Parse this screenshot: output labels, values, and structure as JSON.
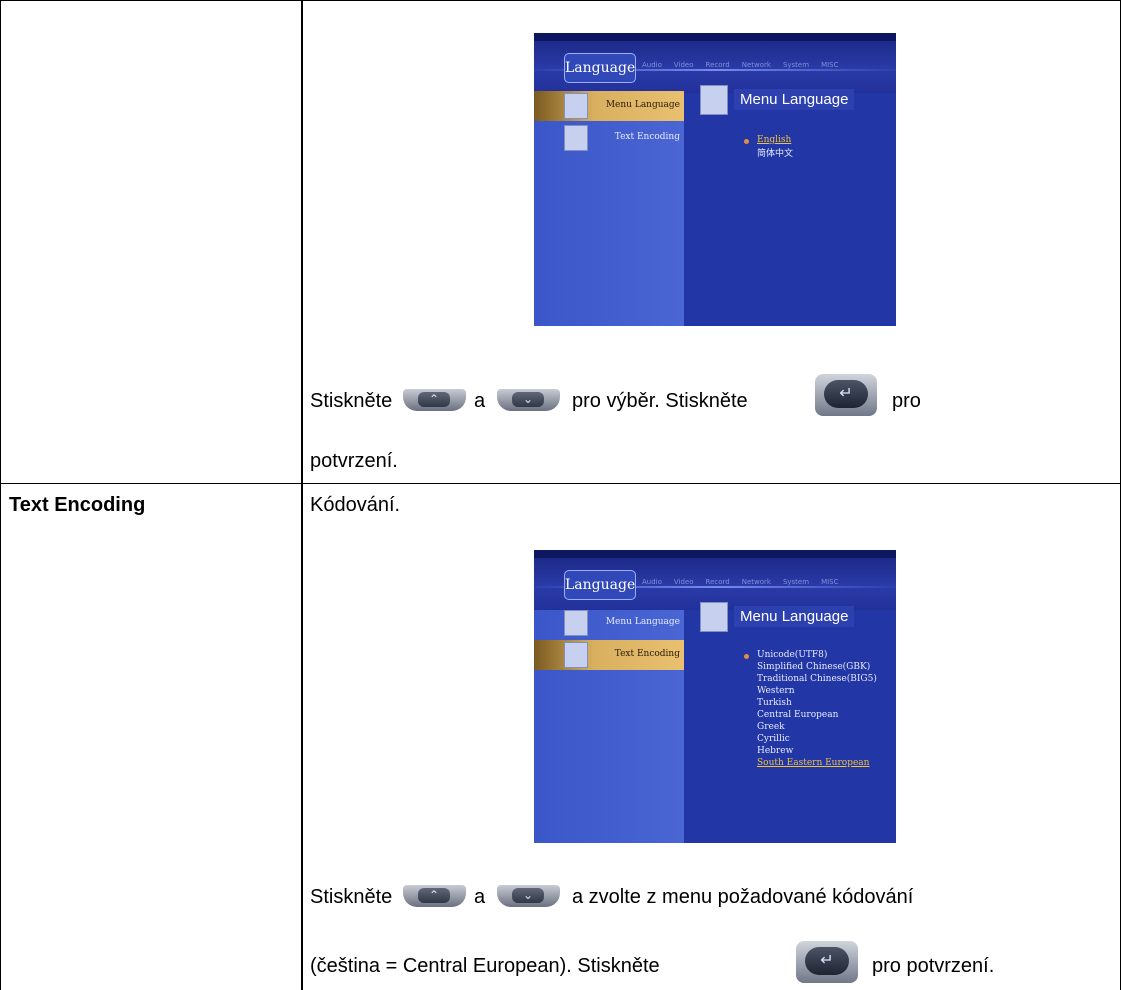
{
  "row_text_encoding": {
    "label": "Text Encoding",
    "desc": "Kódování."
  },
  "instructions_1": {
    "part1": "Stiskněte",
    "part2": "a",
    "part3": "pro výběr. Stiskněte",
    "part4": "pro",
    "line2": "potvrzení."
  },
  "instructions_2": {
    "part1": "Stiskněte",
    "part2": "a",
    "part3": "a zvolte z menu požadované kódování",
    "line2a": "(čeština = Central European). Stiskněte",
    "line2b": "pro potvrzení."
  },
  "screen_common": {
    "tab_active": "Language",
    "tabs": [
      "Audio",
      "Video",
      "Record",
      "Network",
      "System",
      "MISC"
    ],
    "nav": [
      "Menu Language",
      "Text Encoding"
    ],
    "head_title": "Menu Language"
  },
  "screen1": {
    "options": [
      "English",
      "简体中文"
    ]
  },
  "screen2": {
    "options": [
      "Unicode(UTF8)",
      "Simplified Chinese(GBK)",
      "Traditional Chinese(BIG5)",
      "Western",
      "Turkish",
      "Central European",
      "Greek",
      "Cyrillic",
      "Hebrew",
      "South Eastern European"
    ]
  },
  "buttons": {
    "up_glyph": "⌃",
    "down_glyph": "⌄",
    "enter_glyph": "↵"
  }
}
